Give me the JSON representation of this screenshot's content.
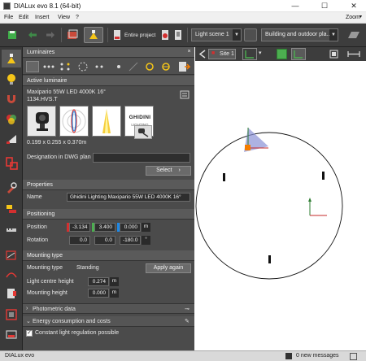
{
  "window": {
    "title": "DIALux evo 8.1  (64-bit)",
    "minimize": "—",
    "maximize": "☐",
    "close": "✕"
  },
  "menu": {
    "items": [
      "File",
      "Edit",
      "Insert",
      "View",
      "?"
    ],
    "zoom_label": "Zoom"
  },
  "toolbar": {
    "project_label": "Entire project",
    "light_scene": "Light scene 1",
    "building_select": "Building and outdoor pla..."
  },
  "luminaires_panel": {
    "header": "Luminaires",
    "active_luminaire_header": "Active luminaire",
    "luminaire_name": "Maxipario 55W LED 4000K 16°",
    "luminaire_code": "1134.HVS.T",
    "brand_logo_text": "GHIDINI",
    "brand_logo_sub": "LIGHTING",
    "dimensions": "0.199 x 0.255 x 0.370m",
    "designation_label": "Designation in DWG plan",
    "designation_value": "",
    "select_button": "Select"
  },
  "properties": {
    "header": "Properties",
    "name_label": "Name",
    "name_value": "Ghidini Lighting  Maxipario 55W LED 4000K 16°"
  },
  "positioning": {
    "header": "Positioning",
    "position_label": "Position",
    "position_x": "-3.134",
    "position_y": "3.400",
    "position_z": "0.000",
    "position_unit": "m",
    "rotation_label": "Rotation",
    "rotation_x": "0.0",
    "rotation_y": "0.0",
    "rotation_z": "-180.0",
    "rotation_unit": "°"
  },
  "mounting": {
    "header": "Mounting type",
    "type_label": "Mounting type",
    "type_value": "Standing",
    "apply_button": "Apply again",
    "centre_height_label": "Light centre height",
    "centre_height_value": "0.274",
    "height_label": "Mounting height",
    "height_value": "0.000",
    "unit": "m"
  },
  "photometric": {
    "header": "Photometric data"
  },
  "energy": {
    "header": "Energy consumption and costs",
    "constant_regulation_label": "Constant light regulation possible",
    "constant_regulation_checked": true
  },
  "canvas": {
    "site_tab": "Site 1"
  },
  "status": {
    "app_name": "DIALux evo",
    "messages": "0 new messages"
  },
  "colors": {
    "panel_bg": "#4b4b4b",
    "toolbar_bg": "#3d3d3d",
    "accent_yellow": "#f5c518",
    "accent_green": "#4caf50",
    "accent_red": "#d32f2f"
  }
}
